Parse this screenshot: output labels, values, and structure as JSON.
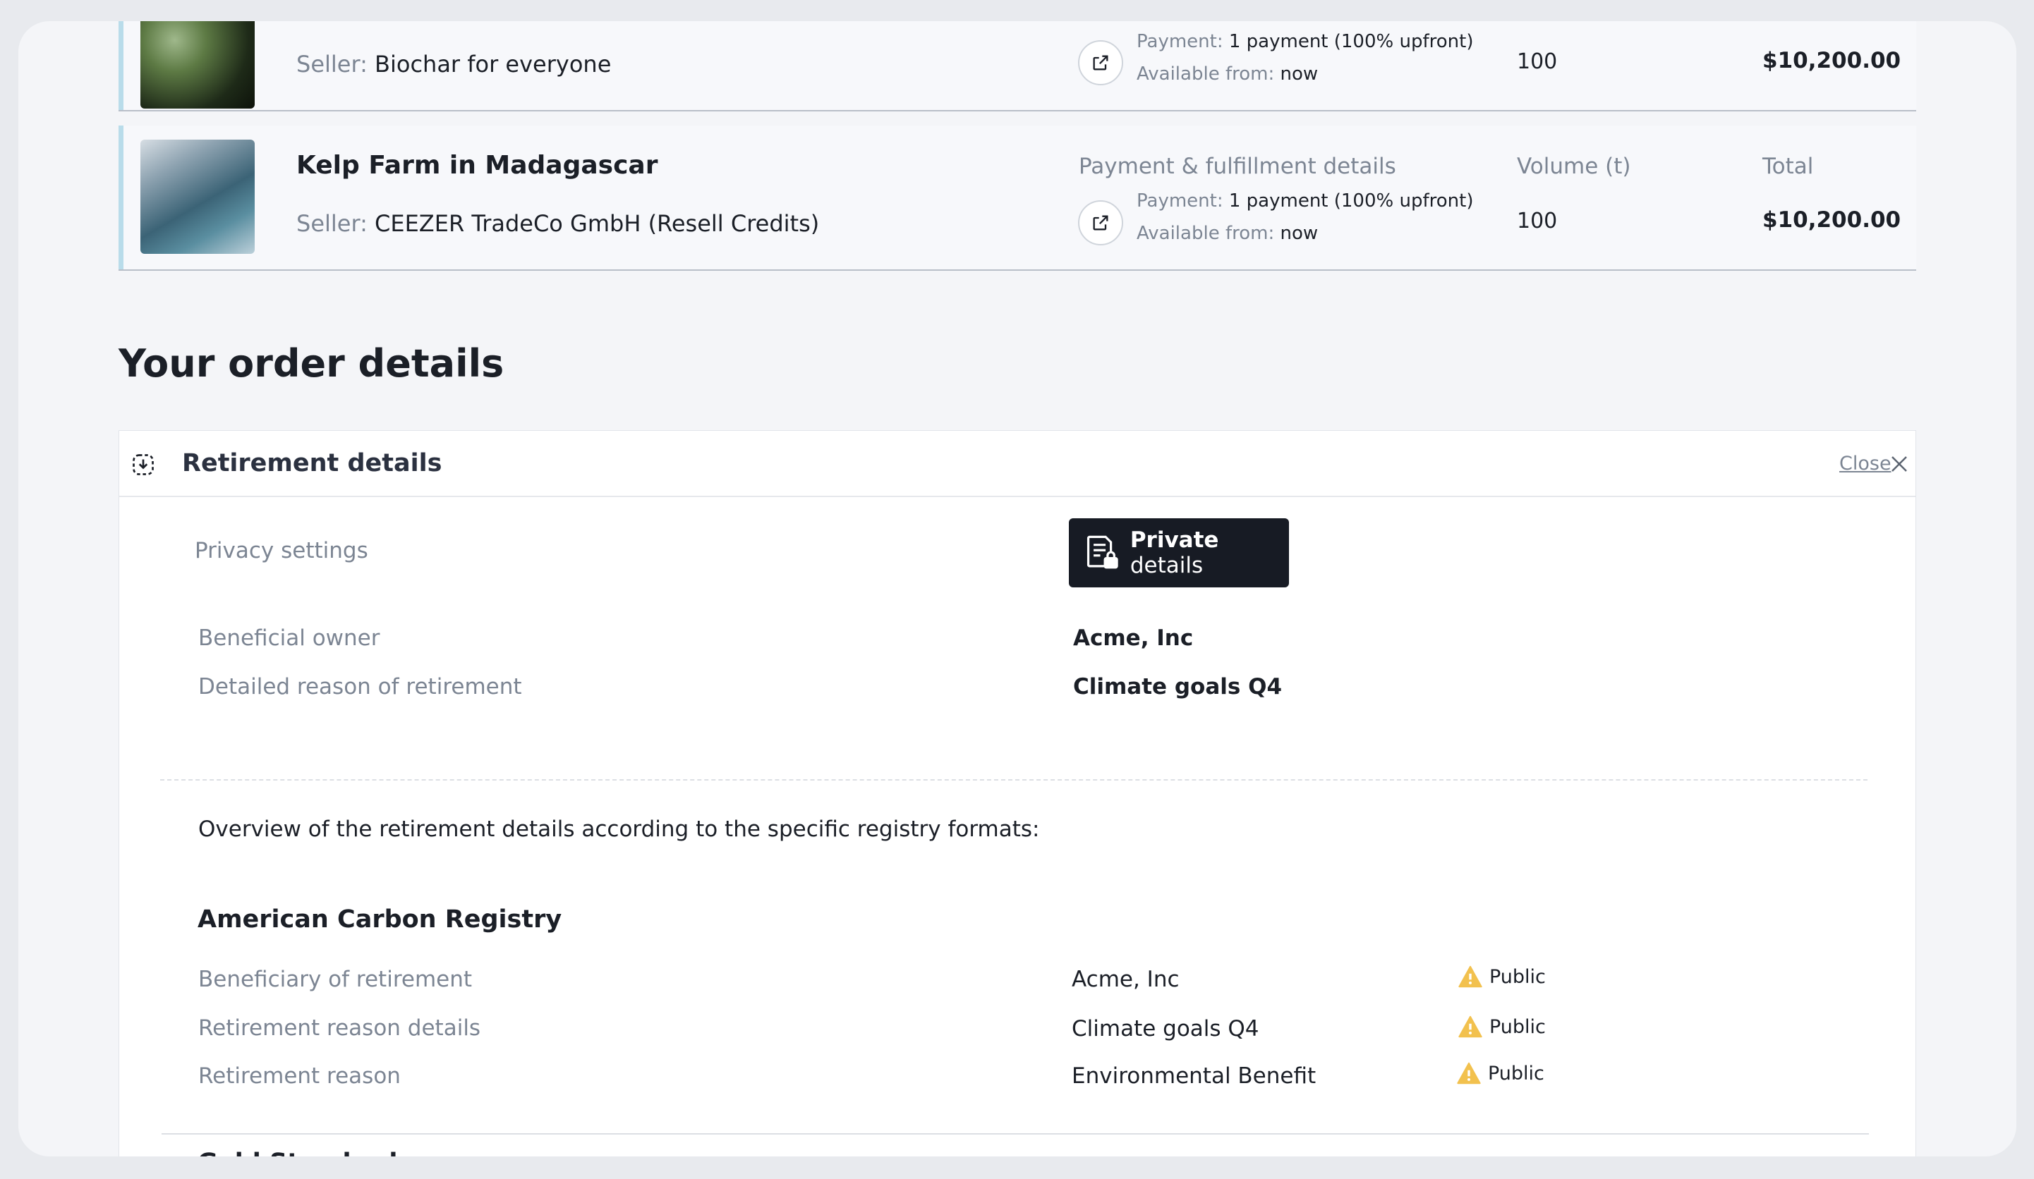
{
  "items": [
    {
      "title": "",
      "seller_label": "Seller:",
      "seller_name": "Biochar for everyone",
      "payment_label": "Payment:",
      "payment_value": "1 payment (100% upfront)",
      "available_label": "Available from:",
      "available_value": "now",
      "volume": "100",
      "total": "$10,200.00"
    },
    {
      "title": "Kelp Farm in Madagascar",
      "seller_label": "Seller:",
      "seller_name": "CEEZER TradeCo GmbH (Resell Credits)",
      "col_payment": "Payment & fulfillment details",
      "col_volume": "Volume (t)",
      "col_total": "Total",
      "payment_label": "Payment:",
      "payment_value": "1 payment (100% upfront)",
      "available_label": "Available from:",
      "available_value": "now",
      "volume": "100",
      "total": "$10,200.00"
    }
  ],
  "order_section_title": "Your order details",
  "panel": {
    "title": "Retirement details",
    "close_label": "Close",
    "privacy_label": "Privacy settings",
    "private_button": {
      "bold": "Private",
      "rest": " details"
    },
    "fields": [
      {
        "label": "Beneficial owner",
        "value": "Acme, Inc"
      },
      {
        "label": "Detailed reason of retirement",
        "value": "Climate goals Q4"
      }
    ],
    "overview_text": "Overview of the retirement details according to the specific registry formats:",
    "registries": [
      {
        "name": "American Carbon Registry",
        "rows": [
          {
            "label": "Beneficiary of retirement",
            "value": "Acme, Inc",
            "visibility": "Public"
          },
          {
            "label": "Retirement reason details",
            "value": "Climate goals Q4",
            "visibility": "Public"
          },
          {
            "label": "Retirement reason",
            "value": "Environmental Benefit",
            "visibility": "Public"
          }
        ]
      },
      {
        "name": "Gold Standard"
      }
    ]
  },
  "colors": {
    "accent": "#b9dcea",
    "warning": "#f2c14e",
    "dark_button": "#171b24"
  }
}
